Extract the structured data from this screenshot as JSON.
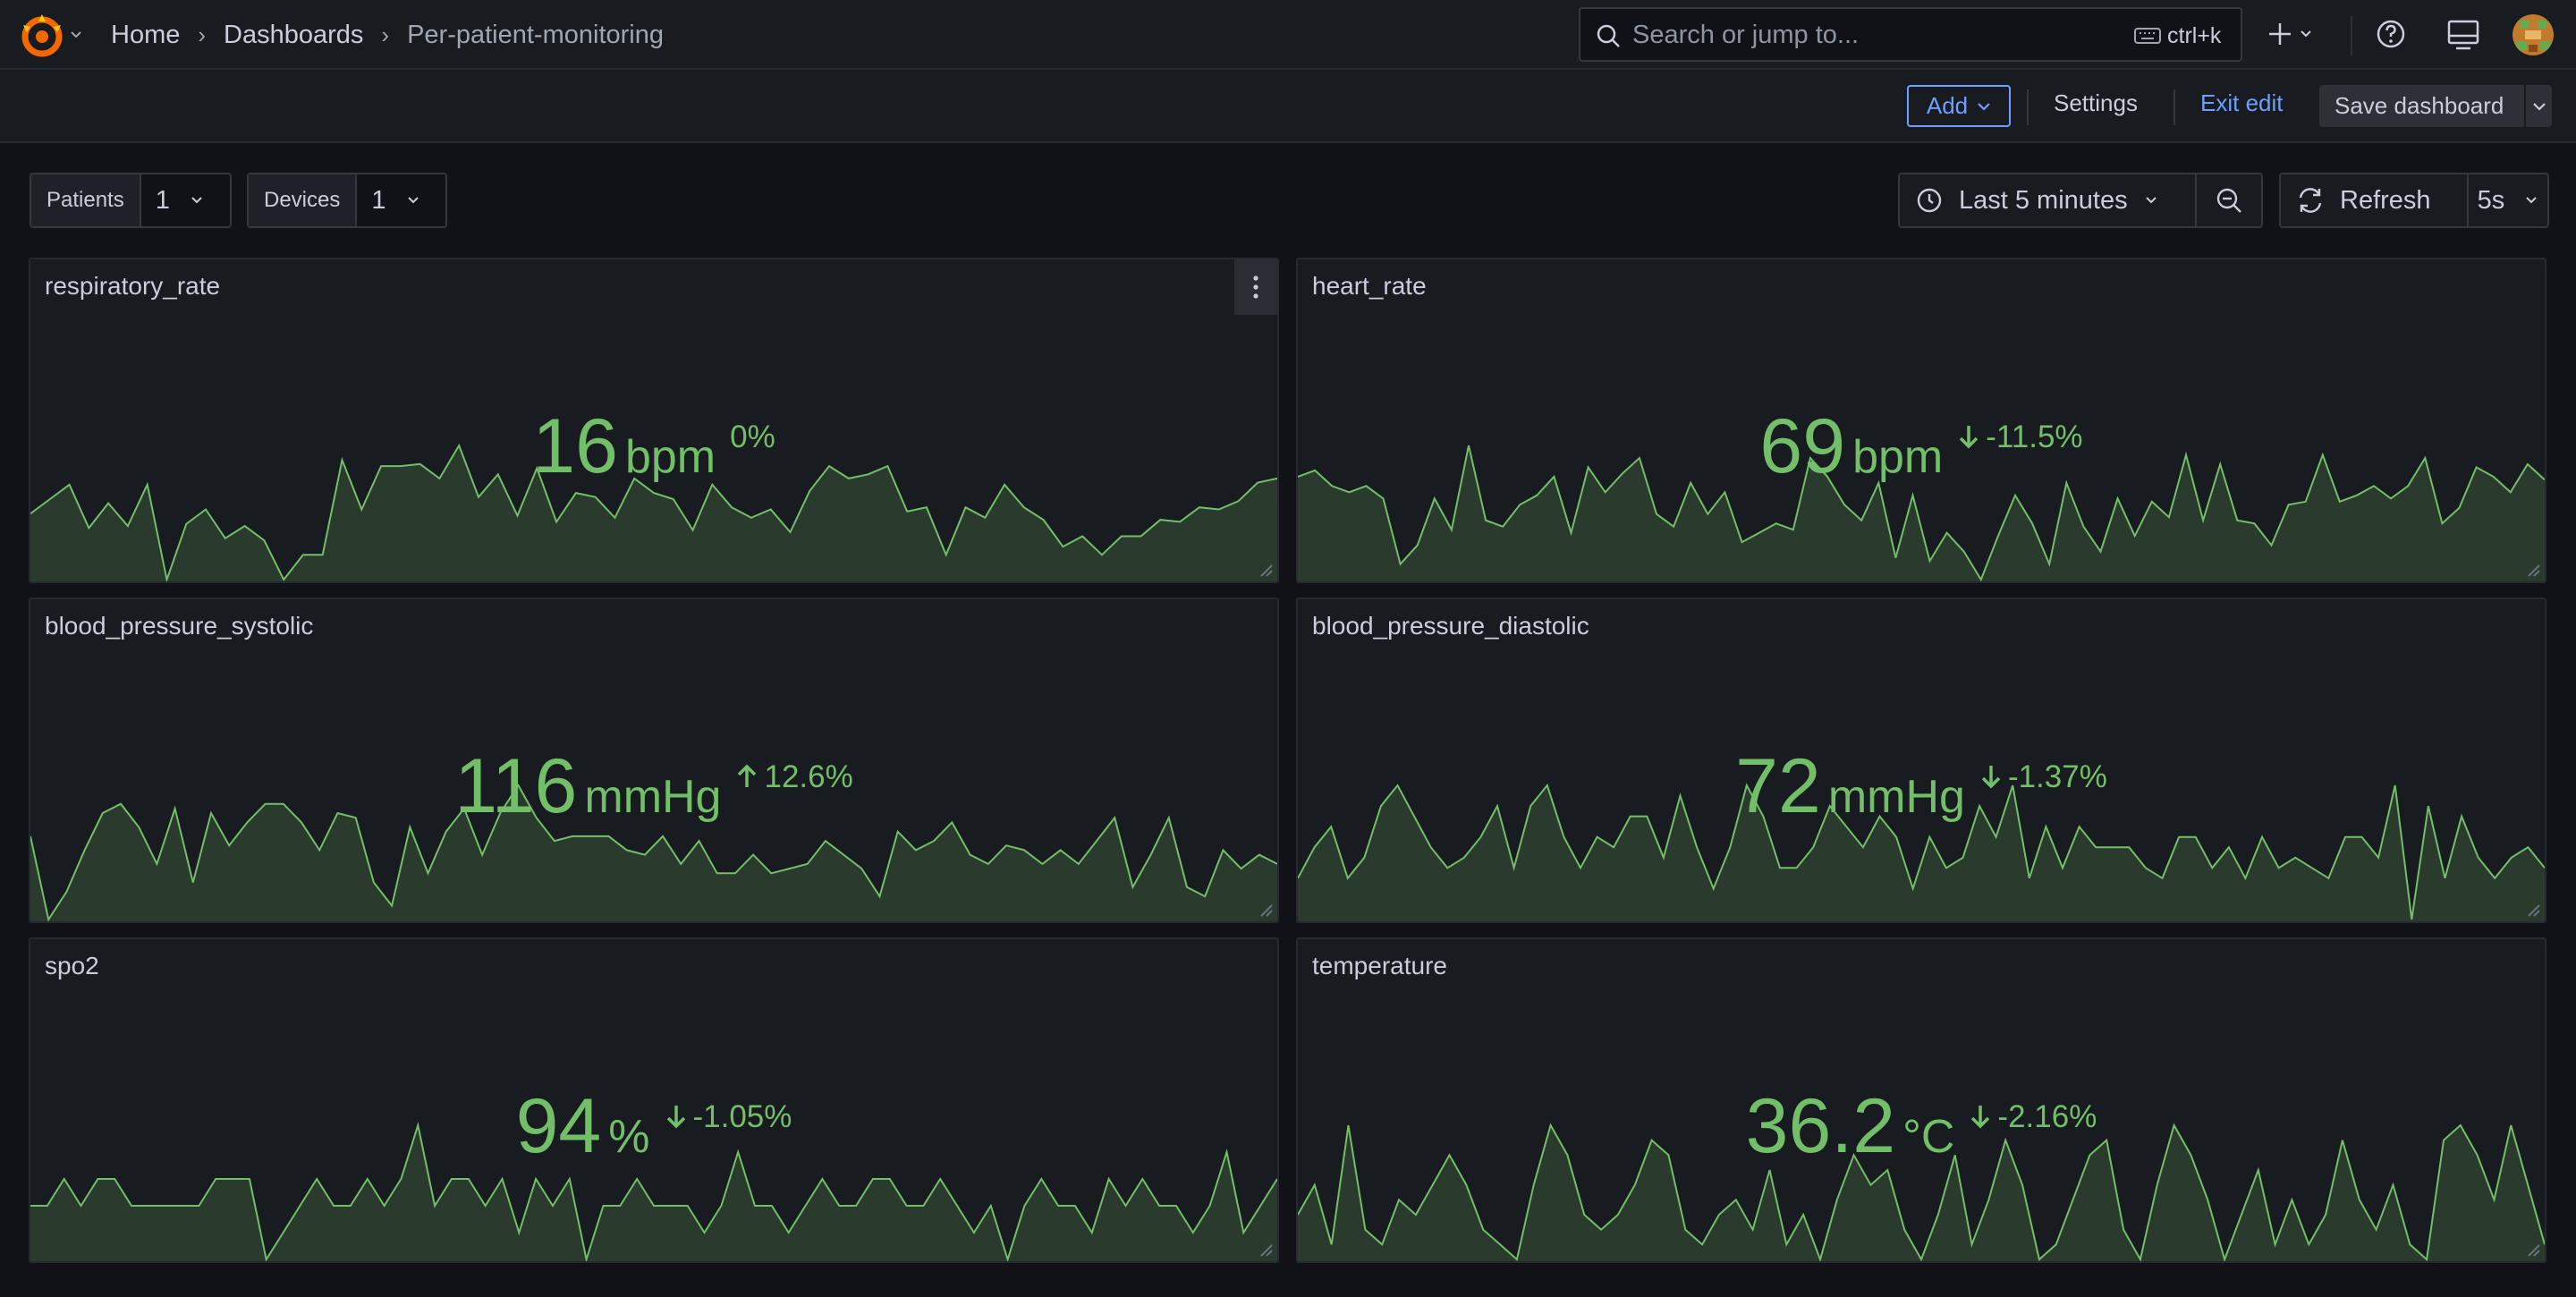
{
  "nav": {
    "breadcrumbs": [
      "Home",
      "Dashboards",
      "Per-patient-monitoring"
    ],
    "search_placeholder": "Search or jump to...",
    "search_shortcut": "ctrl+k"
  },
  "toolbar": {
    "add_label": "Add",
    "settings_label": "Settings",
    "exit_edit_label": "Exit edit",
    "save_label": "Save dashboard"
  },
  "variables": [
    {
      "label": "Patients",
      "value": "1"
    },
    {
      "label": "Devices",
      "value": "1"
    }
  ],
  "time_picker": {
    "range": "Last 5 minutes"
  },
  "refresh": {
    "label": "Refresh",
    "interval": "5s"
  },
  "colors": {
    "background": "#111217",
    "panel": "#181b1f",
    "value_green": "#73bf69",
    "accent_blue": "#6e9fff",
    "orange_logo": "#f46800"
  },
  "panels": [
    {
      "title": "respiratory_rate",
      "value": "16",
      "unit": "bpm",
      "delta": "0%",
      "trend": "none",
      "sparkline": [
        35,
        42,
        49,
        28,
        40,
        29,
        49,
        3,
        30,
        37,
        23,
        29,
        22,
        3,
        15,
        15,
        61,
        37,
        58,
        58,
        59,
        52,
        68,
        43,
        54,
        34,
        57,
        31,
        45,
        43,
        33,
        52,
        45,
        42,
        27,
        49,
        38,
        33,
        37,
        26,
        46,
        58,
        52,
        54,
        58,
        36,
        38,
        15,
        38,
        33,
        49,
        38,
        32,
        19,
        24,
        15,
        24,
        24,
        32,
        31,
        38,
        37,
        41,
        50,
        52
      ]
    },
    {
      "title": "heart_rate",
      "value": "69",
      "unit": "bpm",
      "delta": "-11.5%",
      "trend": "down",
      "sparkline": [
        60,
        62,
        57,
        55,
        57,
        53,
        32,
        38,
        53,
        43,
        70,
        46,
        44,
        51,
        54,
        60,
        42,
        63,
        55,
        61,
        66,
        48,
        44,
        58,
        48,
        55,
        39,
        42,
        45,
        43,
        66,
        60,
        51,
        46,
        58,
        34,
        54,
        33,
        42,
        36,
        27,
        41,
        54,
        45,
        32,
        58,
        44,
        36,
        53,
        41,
        52,
        47,
        67,
        46,
        64,
        46,
        45,
        38,
        51,
        52,
        67,
        52,
        54,
        57,
        53,
        57,
        66,
        45,
        50,
        63,
        60,
        55,
        64,
        59
      ]
    },
    {
      "title": "blood_pressure_systolic",
      "value": "116",
      "unit": "mmHg",
      "delta": "12.6%",
      "trend": "up",
      "sparkline": [
        106,
        88,
        94,
        103,
        111,
        113,
        108,
        100,
        112,
        96,
        111,
        104,
        109,
        113,
        113,
        109,
        103,
        111,
        110,
        96,
        91,
        108,
        98,
        107,
        112,
        102,
        111,
        117,
        110,
        105,
        106,
        106,
        106,
        103,
        102,
        106,
        100,
        105,
        98,
        98,
        102,
        98,
        99,
        100,
        105,
        102,
        99,
        93,
        107,
        103,
        105,
        109,
        102,
        100,
        104,
        103,
        100,
        103,
        100,
        105,
        110,
        95,
        102,
        110,
        95,
        93,
        103,
        99,
        102,
        100
      ]
    },
    {
      "title": "blood_pressure_diastolic",
      "value": "72",
      "unit": "mmHg",
      "delta": "-1.37%",
      "trend": "down",
      "sparkline": [
        69,
        72,
        74,
        69,
        71,
        76,
        78,
        75,
        72,
        70,
        71,
        73,
        76,
        70,
        76,
        78,
        73,
        70,
        73,
        72,
        75,
        75,
        71,
        77,
        72,
        68,
        72,
        78,
        75,
        70,
        70,
        72,
        76,
        74,
        72,
        75,
        73,
        68,
        73,
        70,
        71,
        76,
        73,
        78,
        69,
        74,
        70,
        74,
        72,
        72,
        72,
        70,
        69,
        73,
        73,
        70,
        72,
        69,
        73,
        70,
        71,
        70,
        69,
        73,
        73,
        71,
        78,
        65,
        76,
        69,
        75,
        71,
        69,
        71,
        72,
        70
      ]
    },
    {
      "title": "spo2",
      "value": "94",
      "unit": "%",
      "delta": "-1.05%",
      "trend": "down",
      "sparkline": [
        95,
        95,
        96,
        95,
        96,
        96,
        95,
        95,
        95,
        95,
        95,
        96,
        96,
        96,
        93,
        94,
        95,
        96,
        95,
        95,
        96,
        95,
        96,
        98,
        95,
        96,
        96,
        95,
        96,
        94,
        96,
        95,
        96,
        93,
        95,
        95,
        96,
        95,
        95,
        95,
        94,
        95,
        97,
        95,
        95,
        94,
        95,
        96,
        95,
        95,
        96,
        96,
        95,
        95,
        96,
        95,
        94,
        95,
        93,
        95,
        96,
        95,
        95,
        94,
        96,
        95,
        96,
        95,
        95,
        94,
        95,
        97,
        94,
        95,
        96
      ]
    },
    {
      "title": "temperature",
      "value": "36.2",
      "unit": "°C",
      "delta": "-2.16%",
      "trend": "down",
      "sparkline": [
        36.7,
        36.9,
        36.5,
        37.3,
        36.6,
        36.5,
        36.8,
        36.7,
        36.9,
        37.1,
        36.9,
        36.6,
        36.5,
        36.4,
        36.9,
        37.3,
        37.1,
        36.7,
        36.6,
        36.7,
        36.9,
        37.2,
        37.1,
        36.6,
        36.5,
        36.7,
        36.8,
        36.6,
        37.0,
        36.5,
        36.7,
        36.4,
        36.8,
        37.1,
        36.9,
        37.0,
        36.6,
        36.4,
        36.7,
        37.1,
        36.5,
        36.8,
        37.2,
        36.9,
        36.4,
        36.5,
        36.8,
        37.1,
        37.2,
        36.6,
        36.4,
        36.9,
        37.3,
        37.1,
        36.8,
        36.4,
        36.7,
        37.0,
        36.5,
        36.8,
        36.5,
        36.7,
        37.2,
        36.8,
        36.6,
        36.9,
        36.5,
        36.4,
        37.2,
        37.3,
        37.1,
        36.8,
        37.3,
        36.9,
        36.5
      ]
    }
  ]
}
